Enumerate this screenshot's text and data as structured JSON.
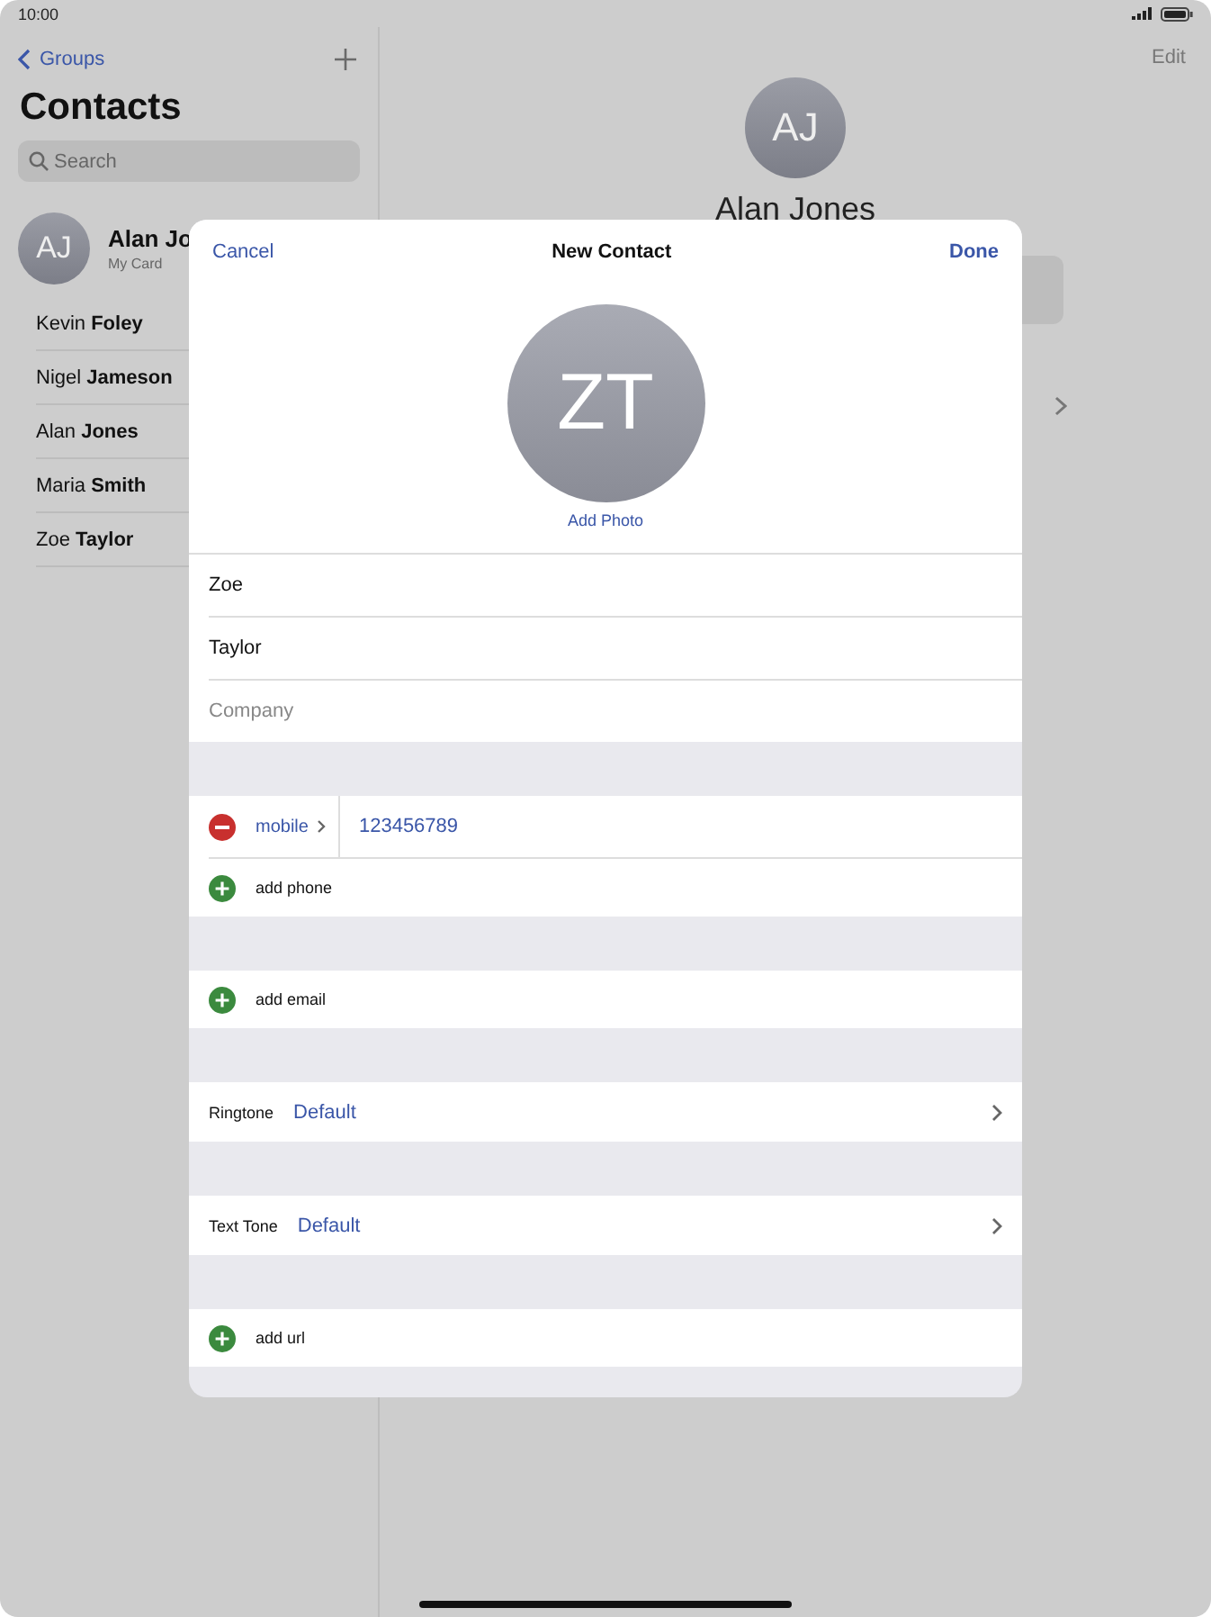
{
  "status_bar": {
    "time": "10:00"
  },
  "sidebar": {
    "back": "Groups",
    "title": "Contacts",
    "search": {
      "placeholder": "Search"
    },
    "my_card": {
      "initials": "AJ",
      "name": "Alan Jo",
      "subtitle": "My Card"
    },
    "contacts": [
      {
        "name": "Kevin **Foley**"
      },
      {
        "name": "Nigel **Jameson**"
      },
      {
        "name": "Alan **Jones**"
      },
      {
        "name": "Maria **Smith**"
      },
      {
        "name": "Zoe **Taylor**"
      }
    ]
  },
  "detail": {
    "edit": "Edit",
    "initials": "AJ",
    "name": "Alan Jones"
  },
  "modal": {
    "cancel": "Cancel",
    "title": "New Contact",
    "done": "Done",
    "initials": "ZT",
    "add_photo": "Add Photo",
    "fields": [
      {
        "value": "Zoe"
      },
      {
        "value": "Taylor"
      },
      {
        "placeholder": "Company"
      }
    ],
    "groups": [
      [
        {
          "kind": "phone",
          "label": "mobile",
          "value": "123456789"
        },
        {
          "kind": "add",
          "label": "add phone"
        }
      ],
      [
        {
          "kind": "add",
          "label": "add email"
        }
      ],
      [
        {
          "kind": "tone",
          "label": "Ringtone",
          "value": "Default"
        }
      ],
      [
        {
          "kind": "tone",
          "label": "Text Tone",
          "value": "Default"
        }
      ],
      [
        {
          "kind": "add",
          "label": "add url"
        }
      ]
    ]
  }
}
